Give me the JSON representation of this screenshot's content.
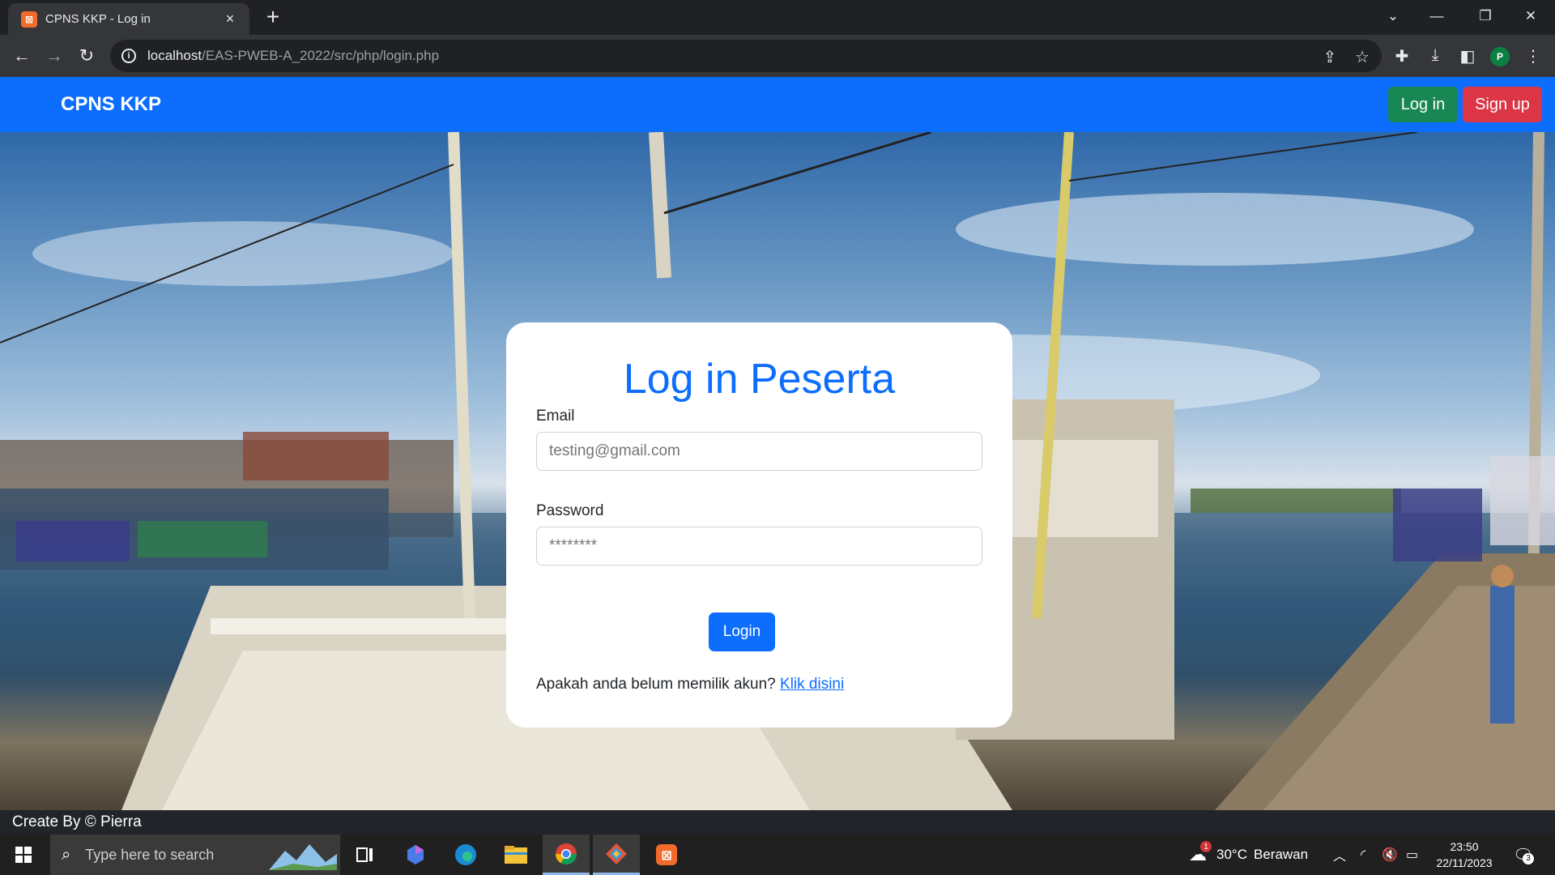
{
  "browser": {
    "tab_title": "CPNS KKP - Log in",
    "tab_favicon": "xampp-icon",
    "url_host": "localhost",
    "url_path": "/EAS-PWEB-A_2022/src/php/login.php",
    "profile_initial": "P"
  },
  "navbar": {
    "brand": "CPNS KKP",
    "login_label": "Log in",
    "signup_label": "Sign up"
  },
  "form": {
    "title": "Log in Peserta",
    "email_label": "Email",
    "email_placeholder": "testing@gmail.com",
    "password_label": "Password",
    "password_placeholder": "********",
    "submit_label": "Login",
    "signup_prompt": "Apakah anda belum memilik akun?",
    "signup_link": "Klik disini"
  },
  "footer": {
    "text": "Create By © Pierra"
  },
  "taskbar": {
    "search_placeholder": "Type here to search",
    "weather": "30°C",
    "weather_desc": "Berawan",
    "time": "23:50",
    "date": "22/11/2023",
    "notification_count": "3",
    "weather_badge": "1"
  },
  "colors": {
    "primary": "#0d6efd",
    "success": "#198754",
    "danger": "#dc3545",
    "footer_bg": "#212529"
  }
}
